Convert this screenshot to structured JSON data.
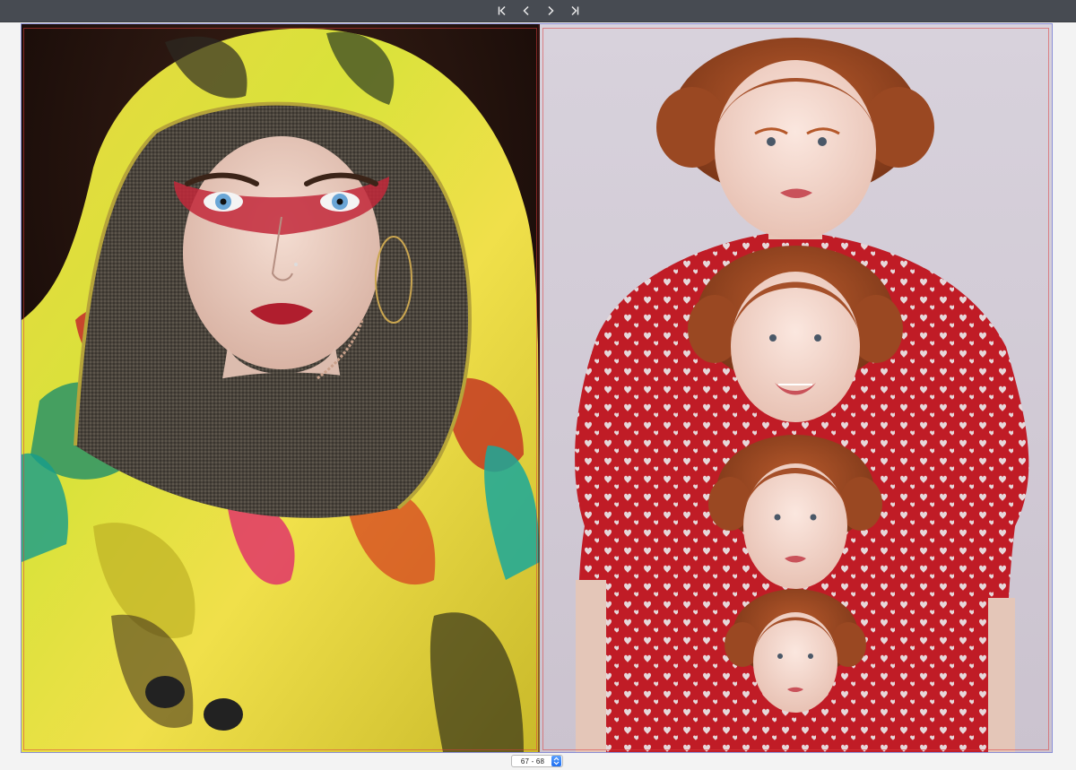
{
  "toolbar": {
    "buttons": [
      {
        "name": "first-page-icon"
      },
      {
        "name": "previous-page-icon"
      },
      {
        "name": "next-page-icon"
      },
      {
        "name": "last-page-icon"
      }
    ]
  },
  "spread": {
    "left_page": {
      "subject": "portrait-hooded-figure"
    },
    "right_page": {
      "subject": "portrait-stacked-figures"
    }
  },
  "page_selector": {
    "value": "67 - 68"
  },
  "colors": {
    "toolbar": "#474b52",
    "frame": "#8b8fd6",
    "trim": "#dc3c3c",
    "accent": "#1f6ff0"
  }
}
